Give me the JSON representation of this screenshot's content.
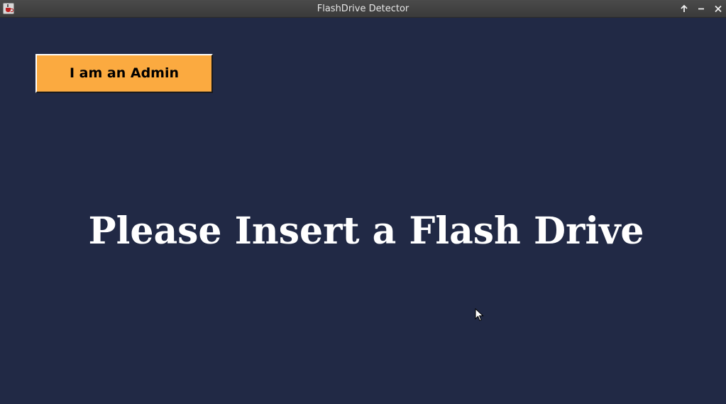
{
  "window": {
    "title": "FlashDrive Detector",
    "controls": {
      "maximize_glyph": "🡑",
      "minimize_glyph": "–",
      "close_glyph": "✕"
    },
    "icons": {
      "app": "java-cup-icon",
      "maximize": "arrow-up-icon",
      "minimize": "minus-icon",
      "close": "close-icon"
    }
  },
  "main": {
    "admin_button_label": "I am an Admin",
    "message": "Please Insert a Flash Drive"
  },
  "colors": {
    "background": "#212945",
    "button": "#fbaa40",
    "message_text": "#ffffff",
    "titlebar": "#404040"
  }
}
